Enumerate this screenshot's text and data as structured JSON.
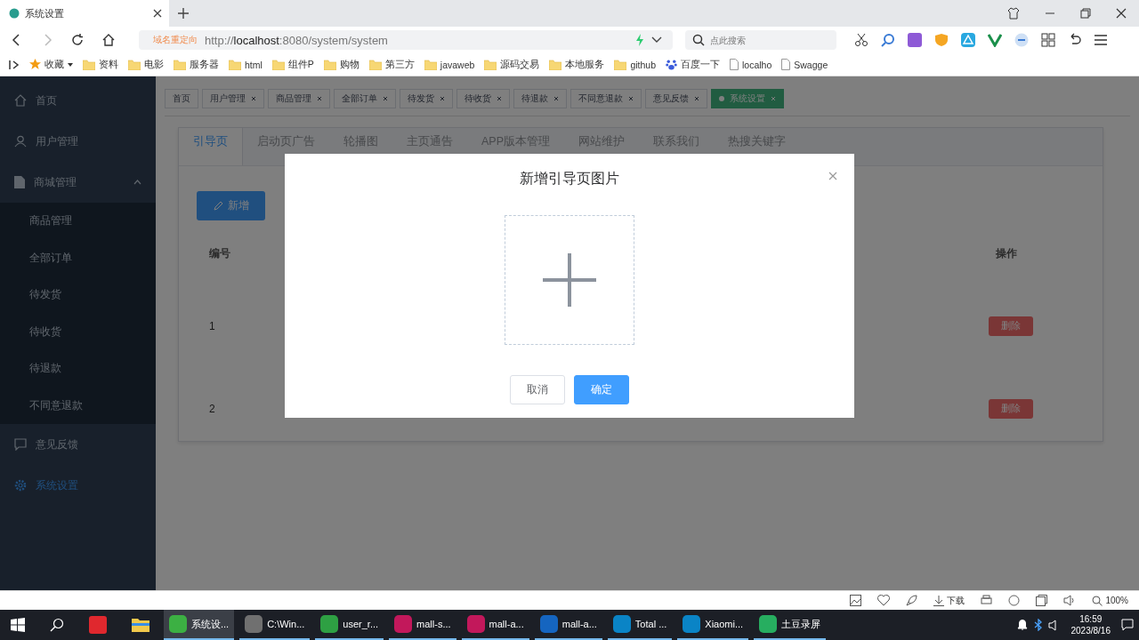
{
  "browser": {
    "tab": {
      "title": "系统设置"
    },
    "address": {
      "badge": "域名重定向",
      "url": "http://**localhost**:8080/system/system"
    },
    "search": {
      "placeholder": "点此搜索"
    },
    "bookmarks": [
      {
        "label": "收藏",
        "kind": "star"
      },
      {
        "label": "资料",
        "kind": "folder"
      },
      {
        "label": "电影",
        "kind": "folder"
      },
      {
        "label": "服务器",
        "kind": "folder"
      },
      {
        "label": "html",
        "kind": "folder"
      },
      {
        "label": "组件P",
        "kind": "folder"
      },
      {
        "label": "购物",
        "kind": "folder"
      },
      {
        "label": "第三方",
        "kind": "folder"
      },
      {
        "label": "javaweb",
        "kind": "folder"
      },
      {
        "label": "源码交易",
        "kind": "folder"
      },
      {
        "label": "本地服务",
        "kind": "folder"
      },
      {
        "label": "github",
        "kind": "folder"
      },
      {
        "label": "百度一下",
        "kind": "paw"
      },
      {
        "label": "localho",
        "kind": "page"
      },
      {
        "label": "Swagge",
        "kind": "page"
      }
    ]
  },
  "sidebar": {
    "items": [
      {
        "label": "首页",
        "selected": false
      },
      {
        "label": "用户管理",
        "selected": false
      },
      {
        "label": "商城管理",
        "selected": false,
        "expanded": true,
        "children": [
          {
            "label": "商品管理",
            "selected": false
          },
          {
            "label": "全部订单",
            "selected": false
          },
          {
            "label": "待发货",
            "selected": false
          },
          {
            "label": "待收货",
            "selected": false
          },
          {
            "label": "待退款",
            "selected": false
          },
          {
            "label": "不同意退款",
            "selected": false
          }
        ]
      },
      {
        "label": "意见反馈",
        "selected": false
      },
      {
        "label": "系统设置",
        "selected": true
      }
    ]
  },
  "tags": [
    {
      "label": "首页",
      "selected": false
    },
    {
      "label": "用户管理",
      "selected": false
    },
    {
      "label": "商品管理",
      "selected": false
    },
    {
      "label": "全部订单",
      "selected": false
    },
    {
      "label": "待发货",
      "selected": false
    },
    {
      "label": "待收货",
      "selected": false
    },
    {
      "label": "待退款",
      "selected": false
    },
    {
      "label": "不同意退款",
      "selected": false
    },
    {
      "label": "意见反馈",
      "selected": false
    },
    {
      "label": "系统设置",
      "selected": true
    }
  ],
  "tabs": [
    {
      "label": "引导页",
      "selected": true
    },
    {
      "label": "启动页广告",
      "selected": false
    },
    {
      "label": "轮播图",
      "selected": false
    },
    {
      "label": "主页通告",
      "selected": false
    },
    {
      "label": "APP版本管理",
      "selected": false
    },
    {
      "label": "网站维护",
      "selected": false
    },
    {
      "label": "联系我们",
      "selected": false
    },
    {
      "label": "热搜关键字",
      "selected": false
    }
  ],
  "table": {
    "new_button": "新增",
    "columns": [
      "编号",
      "操作"
    ],
    "rows": [
      {
        "id": "1",
        "action": "删除"
      },
      {
        "id": "2",
        "action": "删除"
      }
    ]
  },
  "dialog": {
    "title": "新增引导页图片",
    "buttons": [
      {
        "label": "取消",
        "kind": "plain"
      },
      {
        "label": "确定",
        "kind": "primary"
      }
    ]
  },
  "status_bar": {
    "download": "下载",
    "zoom": "100%"
  },
  "taskbar": {
    "apps": [
      {
        "label": "系统设...",
        "selected": true
      },
      {
        "label": "C:\\Win...",
        "selected": false
      },
      {
        "label": "user_r...",
        "selected": false
      },
      {
        "label": "mall-s...",
        "selected": false
      },
      {
        "label": "mall-a...",
        "selected": false
      },
      {
        "label": "mall-a...",
        "selected": false
      },
      {
        "label": "Total ...",
        "selected": false
      },
      {
        "label": "Xiaomi...",
        "selected": false
      },
      {
        "label": "土豆录屏",
        "selected": false
      }
    ],
    "time": "16:59",
    "date": "2023/8/16"
  }
}
